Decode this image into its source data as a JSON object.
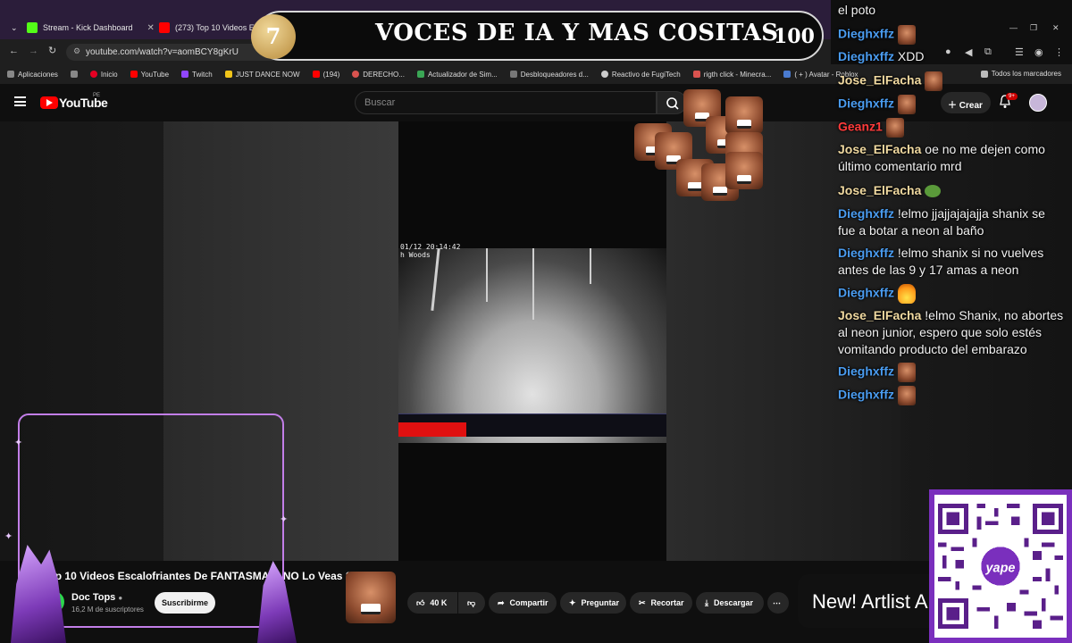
{
  "browser": {
    "tabs": [
      {
        "title": "Stream - Kick Dashboard",
        "color": "#53fc18"
      },
      {
        "title": "(273) Top 10 Videos Escalo",
        "color": "#ff0000"
      }
    ],
    "url": "youtube.com/watch?v=aomBCY8gKrU",
    "bookmarks": [
      {
        "label": "Aplicaciones",
        "color": "#888888"
      },
      {
        "label": "Inicio",
        "color": "#e60023"
      },
      {
        "label": "YouTube",
        "color": "#ff0000"
      },
      {
        "label": "Twitch",
        "color": "#9146ff"
      },
      {
        "label": "JUST DANCE NOW",
        "color": "#f0c419"
      },
      {
        "label": "(194)",
        "color": "#ff0000"
      },
      {
        "label": "DERECHO...",
        "color": "#d9534f"
      },
      {
        "label": "Actualizador de Sim...",
        "color": "#3aa655"
      },
      {
        "label": "Desbloqueadores d...",
        "color": "#777777"
      },
      {
        "label": "Reactivo de FugiTech",
        "color": "#cccccc"
      },
      {
        "label": "rigth click - Minecra...",
        "color": "#d9534f"
      },
      {
        "label": "( + ) Avatar - Roblox",
        "color": "#4a7bd0"
      }
    ],
    "all_bookmarks": "Todos los marcadores"
  },
  "banner": {
    "coin": "7",
    "title": "VOCES DE IA Y MAS COSITAS",
    "number": "100"
  },
  "youtube": {
    "logo_text": "YouTube",
    "country": "PE",
    "search_placeholder": "Buscar",
    "create_label": "Crear",
    "notif_badge": "9+",
    "video_title": "Top 10 Videos Escalofriantes De FANTASMAS: NO Lo Veas Solo",
    "channel_name": "Doc Tops",
    "channel_subs": "16,2 M de suscriptores",
    "subscribe_label": "Suscribirme",
    "likes": "40 K",
    "share_label": "Compartir",
    "ask_label": "Preguntar",
    "clip_label": "Recortar",
    "download_label": "Descargar",
    "more_label": "⋯"
  },
  "camera": {
    "timestamp": "01/12 20:14:42",
    "location": "h Woods"
  },
  "ad": {
    "text": "New! Artlist A"
  },
  "qr": {
    "brand": "yape"
  },
  "chat": {
    "colors": {
      "blue": "#4a9cf0",
      "tan": "#f0d9a0",
      "red": "#ff3b3b"
    },
    "messages": [
      {
        "user": "",
        "text": "el poto",
        "color": "blue",
        "emote": ""
      },
      {
        "user": "Dieghxffz",
        "text": "",
        "color": "blue",
        "emote": "face"
      },
      {
        "user": "Dieghxffz",
        "text": "XDD",
        "color": "blue",
        "emote": ""
      },
      {
        "user": "Jose_ElFacha",
        "text": "",
        "color": "tan",
        "emote": "face"
      },
      {
        "user": "Dieghxffz",
        "text": "",
        "color": "blue",
        "emote": "face"
      },
      {
        "user": "Geanz1",
        "text": "",
        "color": "red",
        "emote": "face"
      },
      {
        "user": "Jose_ElFacha",
        "text": "oe no me dejen como último comentario mrd",
        "color": "tan",
        "emote": ""
      },
      {
        "user": "Jose_ElFacha",
        "text": "",
        "color": "tan",
        "emote": "pepe"
      },
      {
        "user": "Dieghxffz",
        "text": "!elmo jjajjajajajja shanix se fue a botar a neon al baño",
        "color": "blue",
        "emote": ""
      },
      {
        "user": "Dieghxffz",
        "text": "!elmo shanix si no vuelves antes de las 9 y 17 amas a neon",
        "color": "blue",
        "emote": ""
      },
      {
        "user": "Dieghxffz",
        "text": "",
        "color": "blue",
        "emote": "fire"
      },
      {
        "user": "Jose_ElFacha",
        "text": "!elmo Shanix, no abortes al neon junior, espero que solo estés vomitando producto del embarazo",
        "color": "tan",
        "emote": ""
      },
      {
        "user": "Dieghxffz",
        "text": "",
        "color": "blue",
        "emote": "face"
      },
      {
        "user": "Dieghxffz",
        "text": "",
        "color": "blue",
        "emote": "face"
      }
    ]
  }
}
